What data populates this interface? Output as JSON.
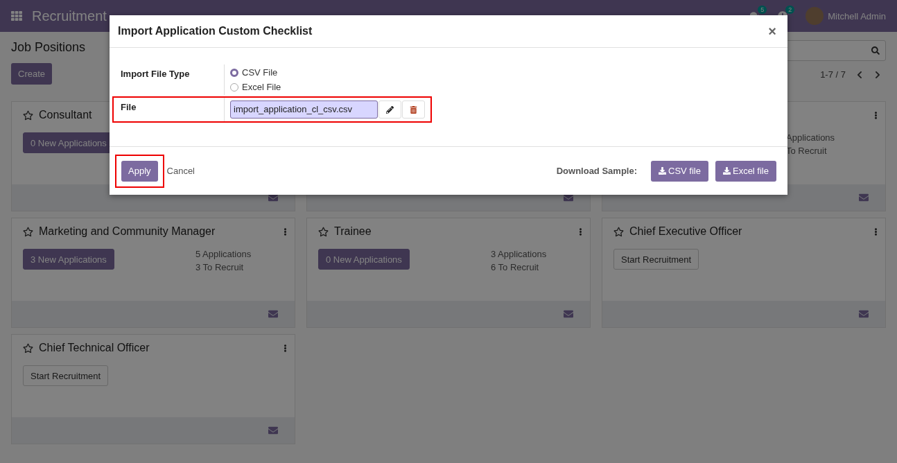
{
  "navbar": {
    "app_name": "Recruitment",
    "messages_count": "5",
    "activities_count": "2",
    "user": "Mitchell Admin"
  },
  "control_panel": {
    "title": "Job Positions",
    "create_label": "Create",
    "pager": "1-7 / 7"
  },
  "cards": [
    {
      "kind": "job",
      "title": "Consultant",
      "button": {
        "label": "0 New Applications",
        "kind": "primary"
      }
    },
    {
      "kind": "covered"
    },
    {
      "stats": [
        "Applications",
        "To Recruit"
      ]
    },
    {
      "title": "Marketing and Community Manager",
      "button": {
        "label": "3 New Applications",
        "kind": "primary"
      },
      "stats": [
        "5 Applications",
        "3 To Recruit"
      ]
    },
    {
      "title": "Trainee",
      "button": {
        "label": "0 New Applications",
        "kind": "primary"
      },
      "stats": [
        "3 Applications",
        "6 To Recruit"
      ]
    },
    {
      "title": "Chief Executive Officer",
      "button": {
        "label": "Start Recruitment",
        "kind": "secondary"
      }
    },
    {
      "title": "Chief Technical Officer",
      "button": {
        "label": "Start Recruitment",
        "kind": "secondary"
      }
    }
  ],
  "dialog": {
    "title": "Import Application Custom Checklist",
    "close": "×",
    "file_type": {
      "label": "Import File Type",
      "options": [
        {
          "label": "CSV File",
          "selected": true
        },
        {
          "label": "Excel File",
          "selected": false
        }
      ]
    },
    "file": {
      "label": "File",
      "value": "import_application_cl_csv.csv",
      "highlighted": true
    },
    "apply": {
      "label": "Apply",
      "highlighted": true
    },
    "cancel": "Cancel",
    "download_label": "Download Sample:",
    "downloads": [
      "CSV file",
      "Excel file"
    ]
  }
}
